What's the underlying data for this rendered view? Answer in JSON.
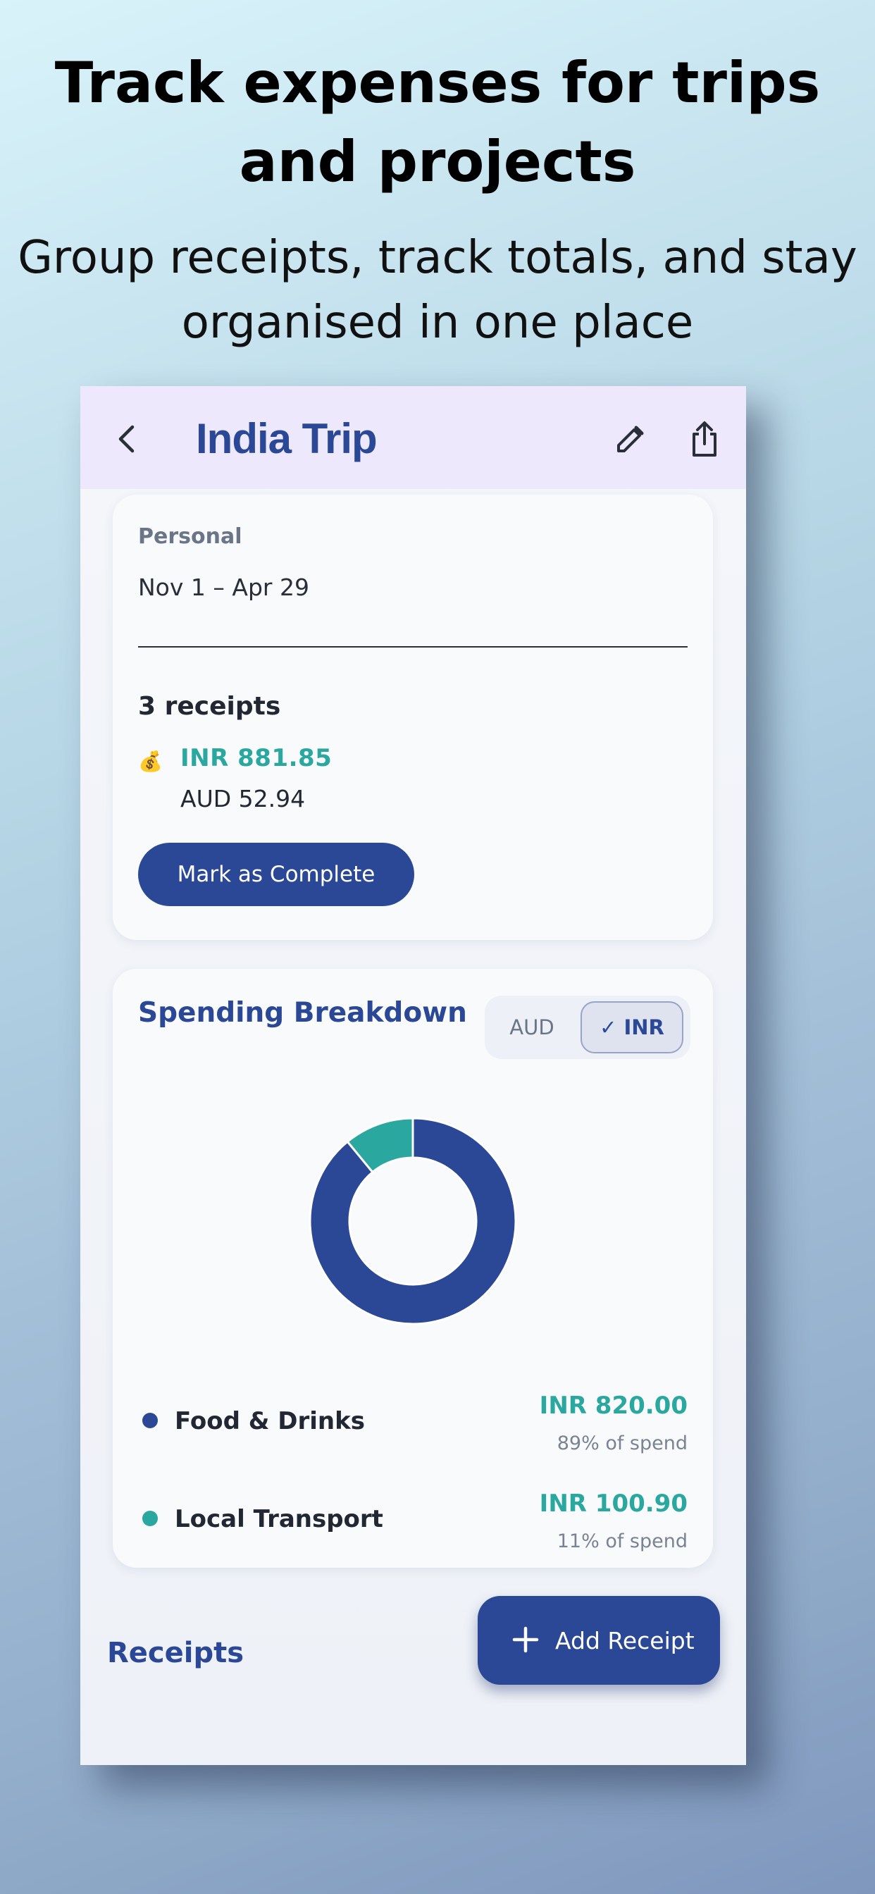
{
  "promo": {
    "headline": "Track expenses for trips and projects",
    "subhead": "Group receipts, track totals, and stay organised in one place"
  },
  "appbar": {
    "title": "India Trip",
    "icons": [
      "back-arrow-icon",
      "pencil-icon",
      "share-icon"
    ]
  },
  "summary": {
    "category": "Personal",
    "dates": "Nov 1 – Apr 29",
    "receipts_count": "3 receipts",
    "money_icon": "💰",
    "total_primary": "INR 881.85",
    "total_secondary": "AUD 52.94",
    "complete_button": "Mark as Complete"
  },
  "breakdown": {
    "title": "Spending Breakdown",
    "currency_options": [
      "AUD",
      "INR"
    ],
    "selected_currency": "INR",
    "check_mark": "✓"
  },
  "chart_data": {
    "type": "pie",
    "donut": true,
    "categories": [
      "Food & Drinks",
      "Local Transport"
    ],
    "values": [
      820.0,
      100.9
    ],
    "colors": [
      "#2b4896",
      "#2aa8a0"
    ]
  },
  "legend": [
    {
      "name": "Food & Drinks",
      "amount": "INR 820.00",
      "share": "89% of spend",
      "color": "#2b4896"
    },
    {
      "name": "Local Transport",
      "amount": "INR 100.90",
      "share": "11% of spend",
      "color": "#2aa8a0"
    }
  ],
  "receipts_section": {
    "title": "Receipts"
  },
  "fab": {
    "label": "Add Receipt"
  },
  "colors": {
    "primary": "#2b4896",
    "accent": "#2aa8a0",
    "appbar_bg": "#ede8fb"
  }
}
